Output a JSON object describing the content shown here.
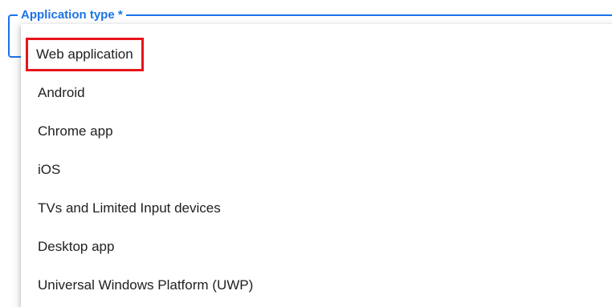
{
  "field": {
    "label": "Application type *",
    "accent_color": "#1a73e8"
  },
  "menu": {
    "highlight_color": "#e8141c",
    "items": [
      {
        "label": "Web application",
        "highlighted": true
      },
      {
        "label": "Android"
      },
      {
        "label": "Chrome app"
      },
      {
        "label": "iOS"
      },
      {
        "label": "TVs and Limited Input devices"
      },
      {
        "label": "Desktop app"
      },
      {
        "label": "Universal Windows Platform (UWP)"
      }
    ]
  }
}
